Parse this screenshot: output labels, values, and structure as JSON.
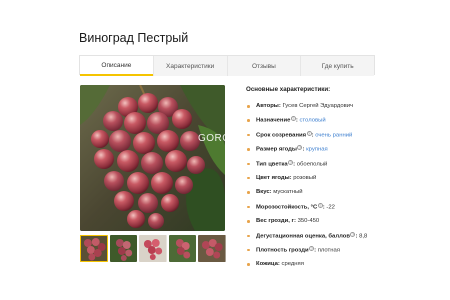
{
  "page_title": "Виноград Пестрый",
  "tabs": [
    {
      "label": "Описание",
      "active": true
    },
    {
      "label": "Характеристики",
      "active": false
    },
    {
      "label": "Отзывы",
      "active": false
    },
    {
      "label": "Где купить",
      "active": false
    }
  ],
  "photo": {
    "watermark": "GORO"
  },
  "characteristics": {
    "title": "Основные характеристики:",
    "items": [
      {
        "label": "Авторы",
        "value": "Гусев Сергей Эдуардович"
      },
      {
        "label": "Назначение",
        "value": "столовый"
      },
      {
        "label": "Срок созревания",
        "value": "очень ранний"
      },
      {
        "label": "Размер ягоды",
        "value": "крупная"
      },
      {
        "label": "Тип цветка",
        "value": "обоеполый"
      },
      {
        "label": "Цвет ягоды",
        "value": "розовый"
      },
      {
        "label": "Вкус",
        "value": "мускатный"
      },
      {
        "label": "Морозостойкость, °С",
        "value": "-22"
      },
      {
        "label": "Вес грозди, г",
        "value": "350-450"
      },
      {
        "label": "Дегустационная оценка, баллов",
        "value": "8,8"
      },
      {
        "label": "Плотность грозди",
        "value": "плотная"
      },
      {
        "label": "Кожица",
        "value": "средняя"
      }
    ]
  },
  "colors": {
    "accent": "#f5c400",
    "link": "#3d7fcf",
    "bullet": "#e8a44c"
  }
}
